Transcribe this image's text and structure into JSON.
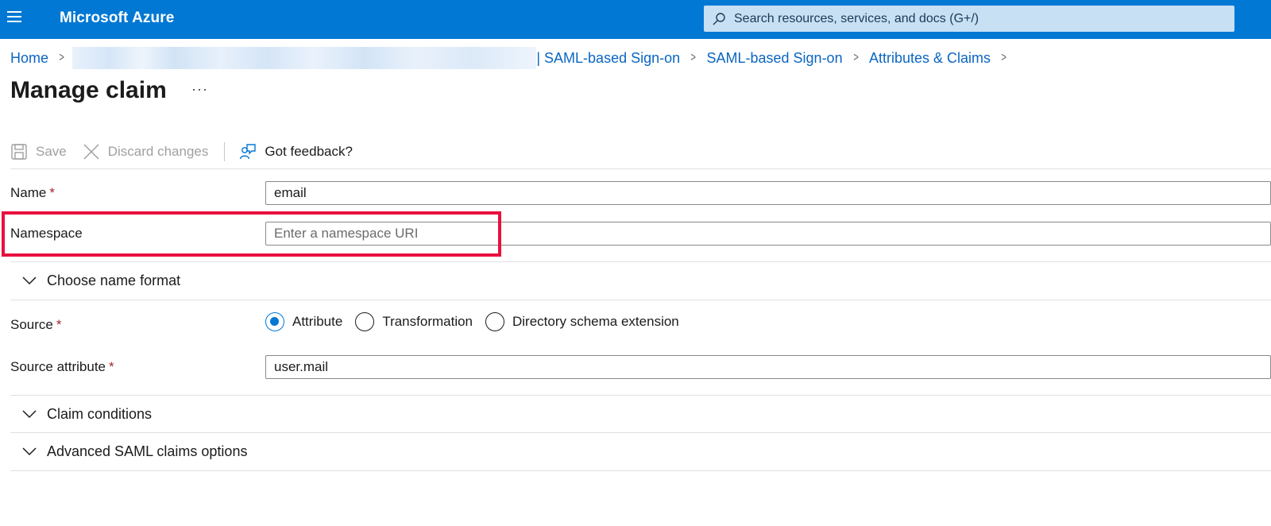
{
  "topbar": {
    "brand": "Microsoft Azure",
    "search_placeholder": "Search resources, services, and docs (G+/)",
    "color": "#0078d4"
  },
  "breadcrumb": {
    "home": "Home",
    "items": [
      "| SAML-based Sign-on",
      "SAML-based Sign-on",
      "Attributes & Claims"
    ]
  },
  "page": {
    "title": "Manage claim",
    "more": "···"
  },
  "toolbar": {
    "save_label": "Save",
    "discard_label": "Discard changes",
    "feedback_label": "Got feedback?"
  },
  "form": {
    "name_label": "Name",
    "name_value": "email",
    "required_mark": "*",
    "namespace_label": "Namespace",
    "namespace_placeholder": "Enter a namespace URI",
    "name_format_section": "Choose name format",
    "source_label": "Source",
    "source_options": [
      "Attribute",
      "Transformation",
      "Directory schema extension"
    ],
    "source_selected": "Attribute",
    "source_attribute_label": "Source attribute",
    "source_attribute_value": "user.mail",
    "claim_conditions_section": "Claim conditions",
    "advanced_section": "Advanced SAML claims options"
  },
  "annotation": {
    "highlight_color": "#e8103e"
  }
}
